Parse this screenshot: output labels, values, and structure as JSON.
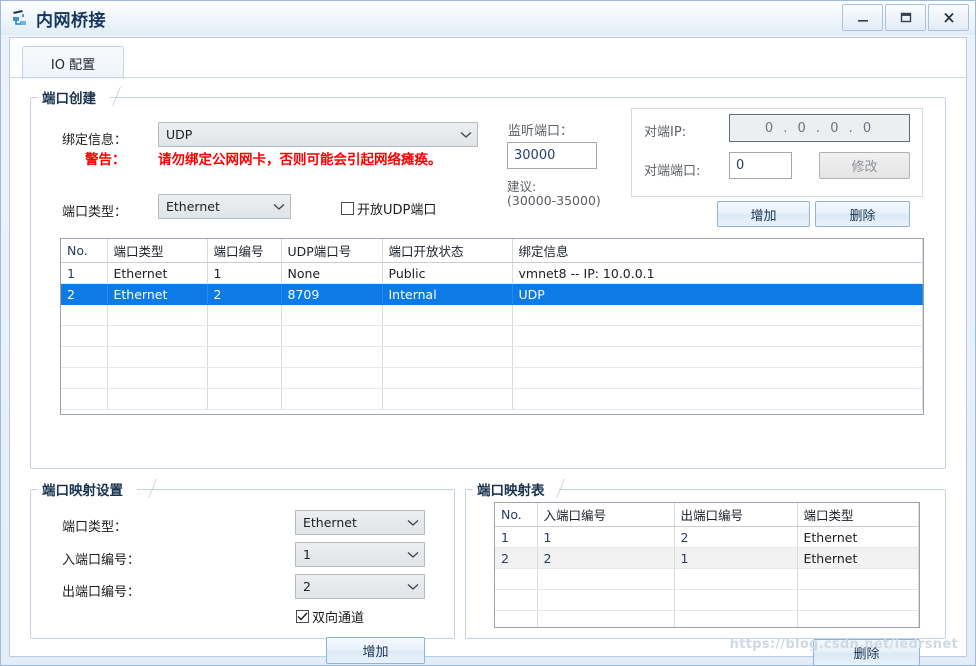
{
  "window": {
    "title": "内网桥接",
    "icon": "bridge-icon",
    "minimize_label": "–",
    "maximize_label": "▢",
    "close_label": "X"
  },
  "tabs": [
    {
      "label": "IO 配置",
      "active": true
    }
  ],
  "port_create": {
    "legend": "端口创建",
    "bind_info_label": "绑定信息：",
    "bind_info_value": "UDP",
    "warning_label": "警告：",
    "warning_text": "请勿绑定公网网卡，否则可能会引起网络瘫痪。",
    "warning_color": "#ff0000",
    "port_type_label": "端口类型：",
    "port_type_value": "Ethernet",
    "open_udp_label": "开放UDP端口",
    "open_udp_checked": false,
    "listen_port_label": "监听端口：",
    "listen_port_value": "30000",
    "suggest_label": "建议:",
    "suggest_range": "(30000-35000)",
    "peer_ip_label": "对端IP:",
    "peer_ip_value": "0 . 0 . 0 . 0",
    "peer_port_label": "对端端口:",
    "peer_port_value": "0",
    "modify_button": "修改",
    "add_button": "增加",
    "delete_button": "删除"
  },
  "port_table": {
    "columns": [
      "No.",
      "端口类型",
      "端口编号",
      "UDP端口号",
      "端口开放状态",
      "绑定信息"
    ],
    "rows": [
      {
        "cells": [
          "1",
          "Ethernet",
          "1",
          "None",
          "Public",
          "vmnet8 -- IP: 10.0.0.1"
        ],
        "selected": false
      },
      {
        "cells": [
          "2",
          "Ethernet",
          "2",
          "8709",
          "Internal",
          "UDP"
        ],
        "selected": true
      }
    ],
    "empty_rows": 5
  },
  "mapping_settings": {
    "legend": "端口映射设置",
    "port_type_label": "端口类型：",
    "port_type_value": "Ethernet",
    "in_port_label": "入端口编号：",
    "in_port_value": "1",
    "out_port_label": "出端口编号：",
    "out_port_value": "2",
    "bidirectional_label": "双向通道",
    "bidirectional_checked": true,
    "add_button": "增加"
  },
  "mapping_table": {
    "legend": "端口映射表",
    "columns": [
      "No.",
      "入端口编号",
      "出端口编号",
      "端口类型"
    ],
    "rows": [
      {
        "cells": [
          "1",
          "1",
          "2",
          "Ethernet"
        ],
        "alt": false
      },
      {
        "cells": [
          "2",
          "2",
          "1",
          "Ethernet"
        ],
        "alt": true
      }
    ],
    "empty_rows": 3,
    "delete_button": "删除"
  },
  "watermark": "https://blog.csdn.net/iedrsnet"
}
